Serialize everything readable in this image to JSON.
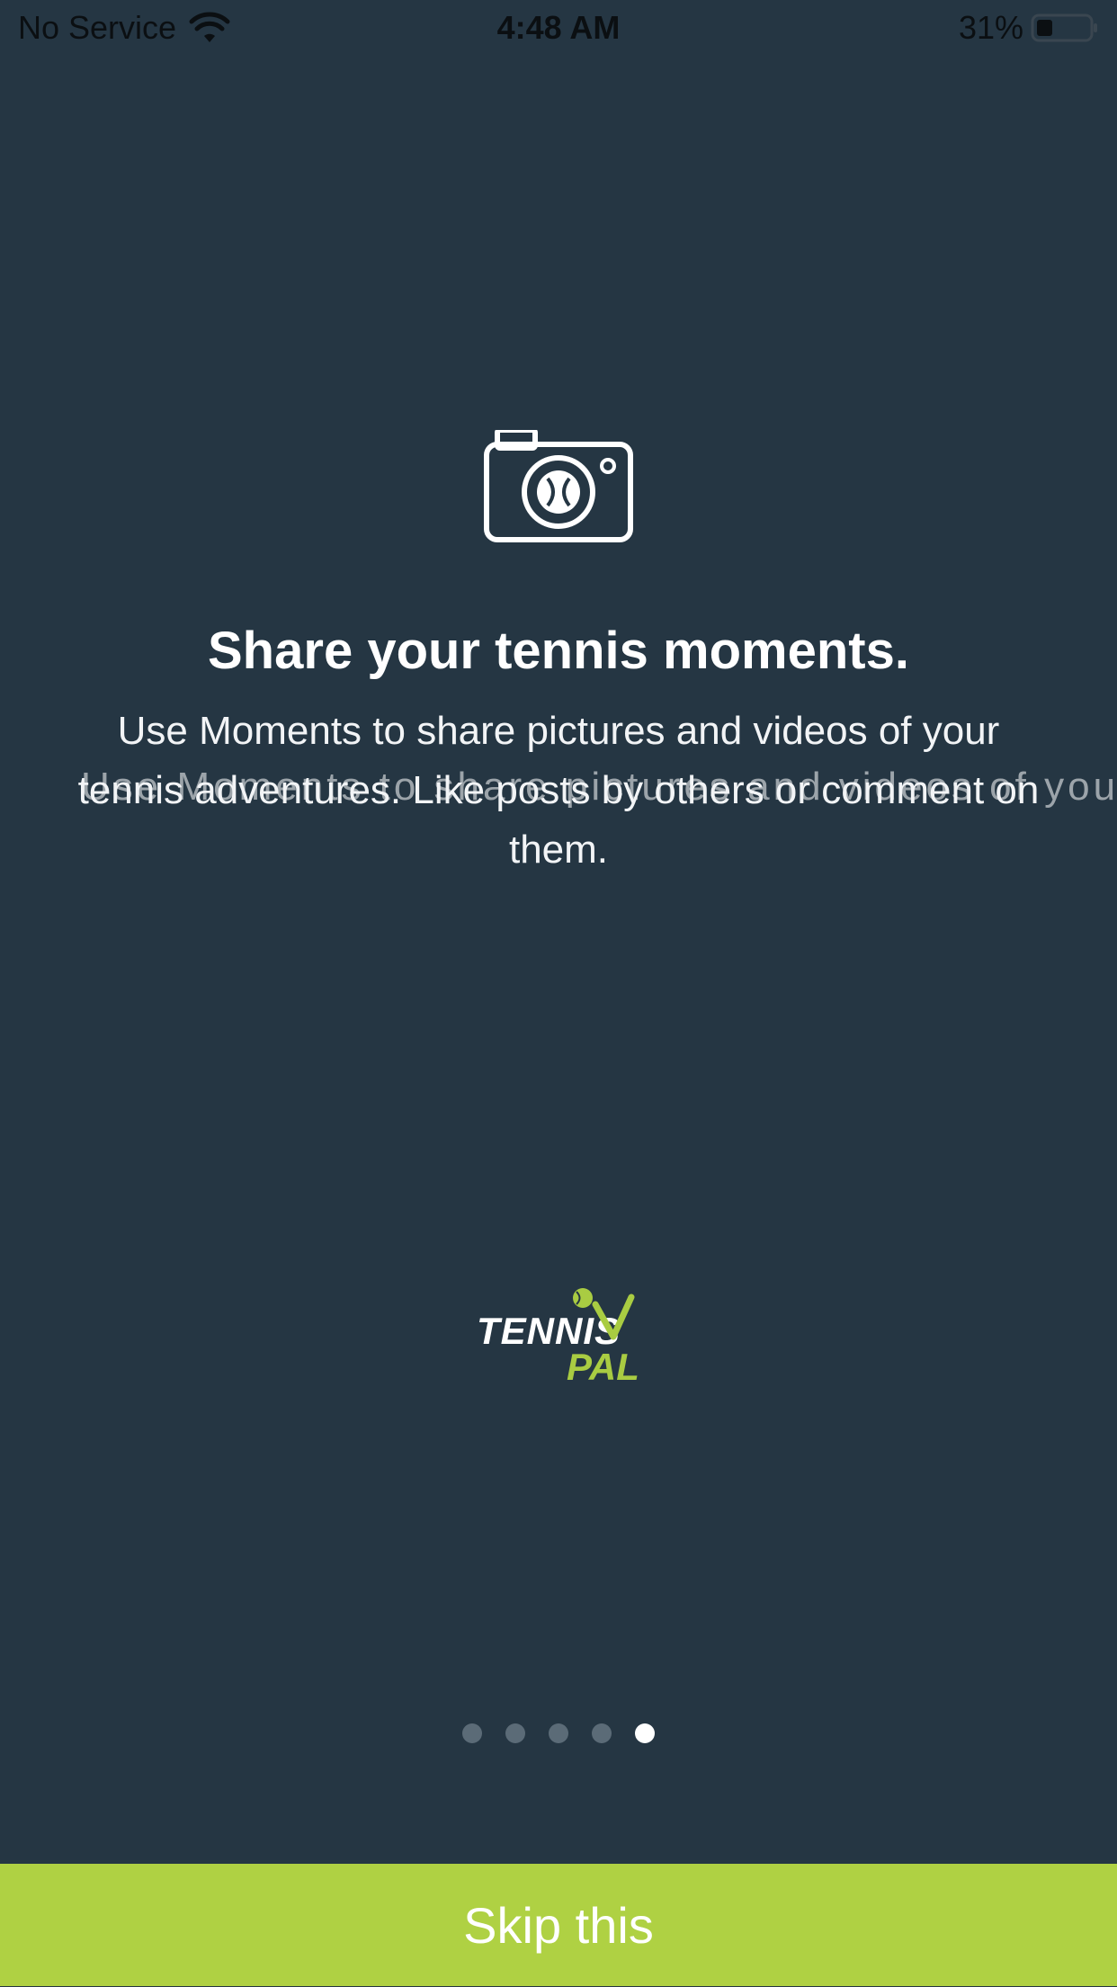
{
  "status_bar": {
    "carrier": "No Service",
    "time": "4:48 AM",
    "battery_percent": "31%",
    "battery_level": 0.31,
    "icons": [
      "wifi-icon",
      "battery-icon"
    ]
  },
  "onboarding": {
    "icon": "camera-icon",
    "title": "Share your tennis moments.",
    "description": "Use Moments to share pictures and videos of your tennis adventures. Like posts by others or comment on them.",
    "ghost_text": "Use Moments to share pictures and videos of your",
    "pages": 5,
    "current_page": 5
  },
  "logo": {
    "word1": "TENNIS",
    "word2": "PAL"
  },
  "skip_button": {
    "label": "Skip this"
  },
  "colors": {
    "background": "#253643",
    "accent": "#afd143",
    "dot_inactive": "#5b6b77",
    "dot_active": "#ffffff"
  }
}
